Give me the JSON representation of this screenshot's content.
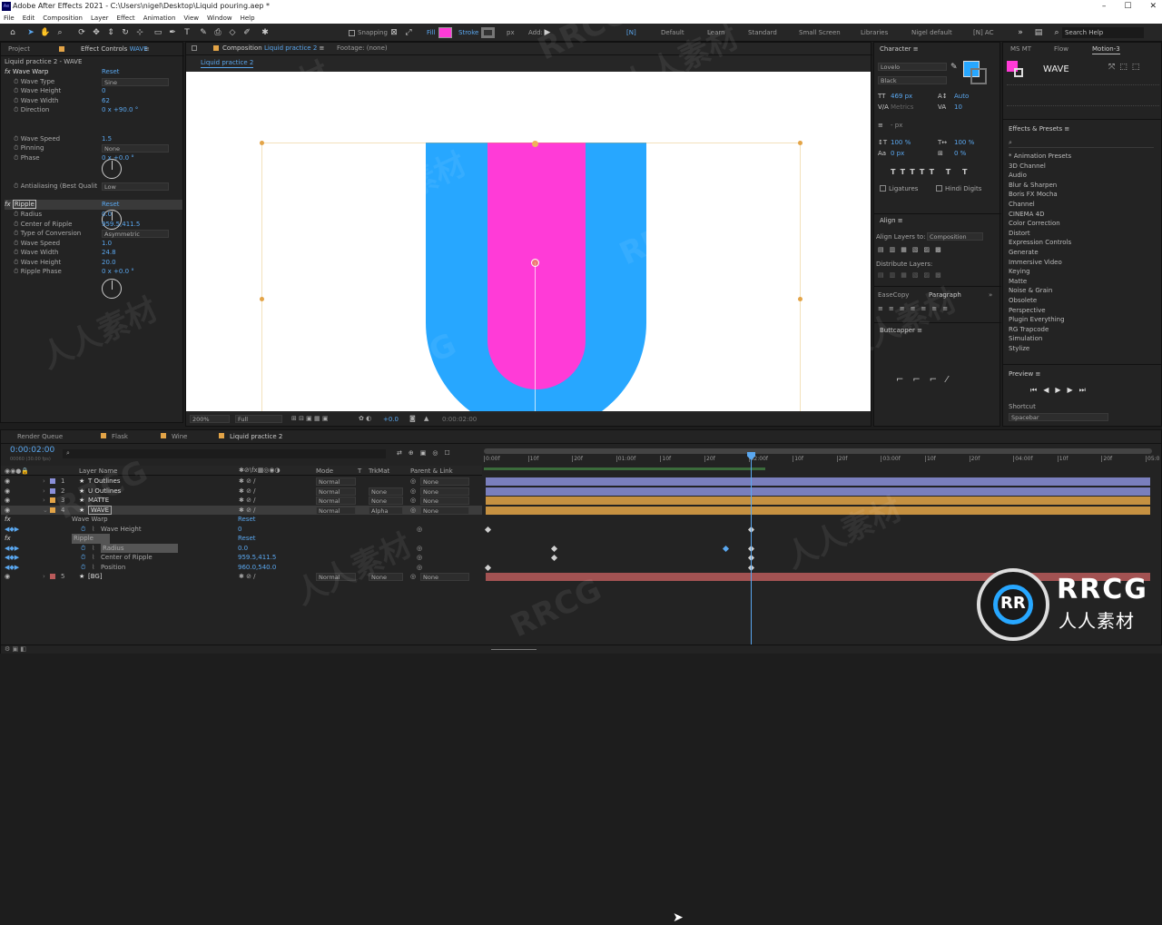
{
  "title": "Adobe After Effects 2021 - C:\\Users\\nigel\\Desktop\\Liquid pouring.aep *",
  "app_icon": "Ae",
  "window_buttons": [
    "–",
    "☐",
    "✕"
  ],
  "menu": [
    "File",
    "Edit",
    "Composition",
    "Layer",
    "Effect",
    "Animation",
    "View",
    "Window",
    "Help"
  ],
  "toolbar": {
    "snapping": "Snapping",
    "fill": "Fill",
    "stroke": "Stroke",
    "px": "px",
    "add": "Add:",
    "workspaces": [
      "Default",
      "Learn",
      "Standard",
      "Small Screen",
      "Libraries",
      "Nigel default"
    ],
    "workspace_n": "[N]",
    "workspace_nac": "[N] AC",
    "search": "Search Help",
    "fill_color": "#ff3bd7",
    "stroke_color": "#555555"
  },
  "project": {
    "tab_project": "Project",
    "tab_effect_controls": "Effect Controls",
    "layer_name": "WAVE",
    "header": "Liquid practice 2 - WAVE",
    "wave_warp": {
      "name": "Wave Warp",
      "reset": "Reset",
      "props": [
        {
          "label": "Wave Type",
          "value": "Sine"
        },
        {
          "label": "Wave Height",
          "value": "0"
        },
        {
          "label": "Wave Width",
          "value": "62"
        },
        {
          "label": "Direction",
          "value": "0 x +90.0 °"
        },
        {
          "label": "Wave Speed",
          "value": "1.5"
        },
        {
          "label": "Pinning",
          "value": "None"
        },
        {
          "label": "Phase",
          "value": "0 x +0.0 °"
        },
        {
          "label": "Antialiasing (Best Qualit",
          "value": "Low"
        }
      ]
    },
    "ripple": {
      "name": "Ripple",
      "reset": "Reset",
      "props": [
        {
          "label": "Radius",
          "value": "0.0"
        },
        {
          "label": "Center of Ripple",
          "value": "959.5,411.5"
        },
        {
          "label": "Type of Conversion",
          "value": "Asymmetric"
        },
        {
          "label": "Wave Speed",
          "value": "1.0"
        },
        {
          "label": "Wave Width",
          "value": "24.8"
        },
        {
          "label": "Wave Height",
          "value": "20.0"
        },
        {
          "label": "Ripple Phase",
          "value": "0 x +0.0 °"
        }
      ]
    }
  },
  "comp": {
    "tab_label": "Composition",
    "comp_name": "Liquid practice 2",
    "footage_tab": "Footage: (none)",
    "breadcrumb": "Liquid practice 2",
    "zoom": "200%",
    "resolution": "Full",
    "exposure": "+0.0",
    "timecode": "0:00:02:00",
    "colors": {
      "blue": "#27a7ff",
      "pink": "#ff3bd7",
      "bg": "#ffffff"
    }
  },
  "character": {
    "title": "Character",
    "font": "Lovelo",
    "style": "Black",
    "size": "469 px",
    "leading": "Auto",
    "kerning": "Metrics",
    "tracking": "10",
    "stroke_px": "- px",
    "vscale": "100 %",
    "hscale": "100 %",
    "baseline": "0 px",
    "tsume": "0 %",
    "ligatures": "Ligatures",
    "hindi": "Hindi Digits",
    "text_color": "#27a7ff"
  },
  "align": {
    "title": "Align",
    "align_to_label": "Align Layers to:",
    "align_to": "Composition",
    "distribute": "Distribute Layers:"
  },
  "ease_copy": {
    "tab": "EaseCopy",
    "tab2": "Paragraph"
  },
  "buttcapper": {
    "title": "Buttcapper"
  },
  "right_col": {
    "tabs": [
      "MS MT",
      "Flow",
      "Motion-3"
    ],
    "layer_label": "WAVE",
    "effects_title": "Effects & Presets",
    "effects": [
      "* Animation Presets",
      "3D Channel",
      "Audio",
      "Blur & Sharpen",
      "Boris FX Mocha",
      "Channel",
      "CINEMA 4D",
      "Color Correction",
      "Distort",
      "Expression Controls",
      "Generate",
      "Immersive Video",
      "Keying",
      "Matte",
      "Noise & Grain",
      "Obsolete",
      "Perspective",
      "Plugin Everything",
      "RG Trapcode",
      "Simulation",
      "Stylize"
    ],
    "preview_title": "Preview",
    "shortcut_label": "Shortcut",
    "shortcut_value": "Spacebar"
  },
  "timeline": {
    "tabs": [
      "Render Queue",
      "Flask",
      "Wine",
      "Liquid practice 2"
    ],
    "timecode": "0:00:02:00",
    "sub_timecode": "00060 (30.00 fps)",
    "columns": {
      "layer_name": "Layer Name",
      "mode": "Mode",
      "t": "T",
      "trkmat": "TrkMat",
      "parent": "Parent & Link"
    },
    "ruler": [
      "0:00f",
      "10f",
      "20f",
      "01:00f",
      "10f",
      "20f",
      "02:00f",
      "10f",
      "20f",
      "03:00f",
      "10f",
      "20f",
      "04:00f",
      "10f",
      "20f",
      "05:0"
    ],
    "layers": [
      {
        "num": "1",
        "name": "T Outlines",
        "mode": "Normal",
        "trkmat": "",
        "parent": "None",
        "color": "#8a8fd8"
      },
      {
        "num": "2",
        "name": "U Outlines",
        "mode": "Normal",
        "trkmat": "None",
        "parent": "None",
        "color": "#8a8fd8"
      },
      {
        "num": "3",
        "name": "MATTE",
        "mode": "Normal",
        "trkmat": "None",
        "parent": "None",
        "color": "#e3a447"
      },
      {
        "num": "4",
        "name": "WAVE",
        "mode": "Normal",
        "trkmat": "Alpha",
        "parent": "None",
        "color": "#e3a447"
      }
    ],
    "props": [
      {
        "label": "Wave Warp",
        "value": "Reset",
        "indent": 1
      },
      {
        "label": "Wave Height",
        "value": "0",
        "indent": 2
      },
      {
        "label": "Ripple",
        "value": "Reset",
        "indent": 1
      },
      {
        "label": "Radius",
        "value": "0.0",
        "indent": 2
      },
      {
        "label": "Center of Ripple",
        "value": "959.5,411.5",
        "indent": 2
      },
      {
        "label": "Position",
        "value": "960.0,540.0",
        "indent": 2
      }
    ],
    "bg_layer": {
      "num": "5",
      "name": "[BG]",
      "mode": "Normal",
      "trkmat": "None",
      "parent": "None",
      "color": "#b95a5a"
    }
  },
  "watermarks": [
    "RRCG",
    "人人素材"
  ],
  "logo": {
    "big": "RRCG",
    "small": "人人素材"
  }
}
